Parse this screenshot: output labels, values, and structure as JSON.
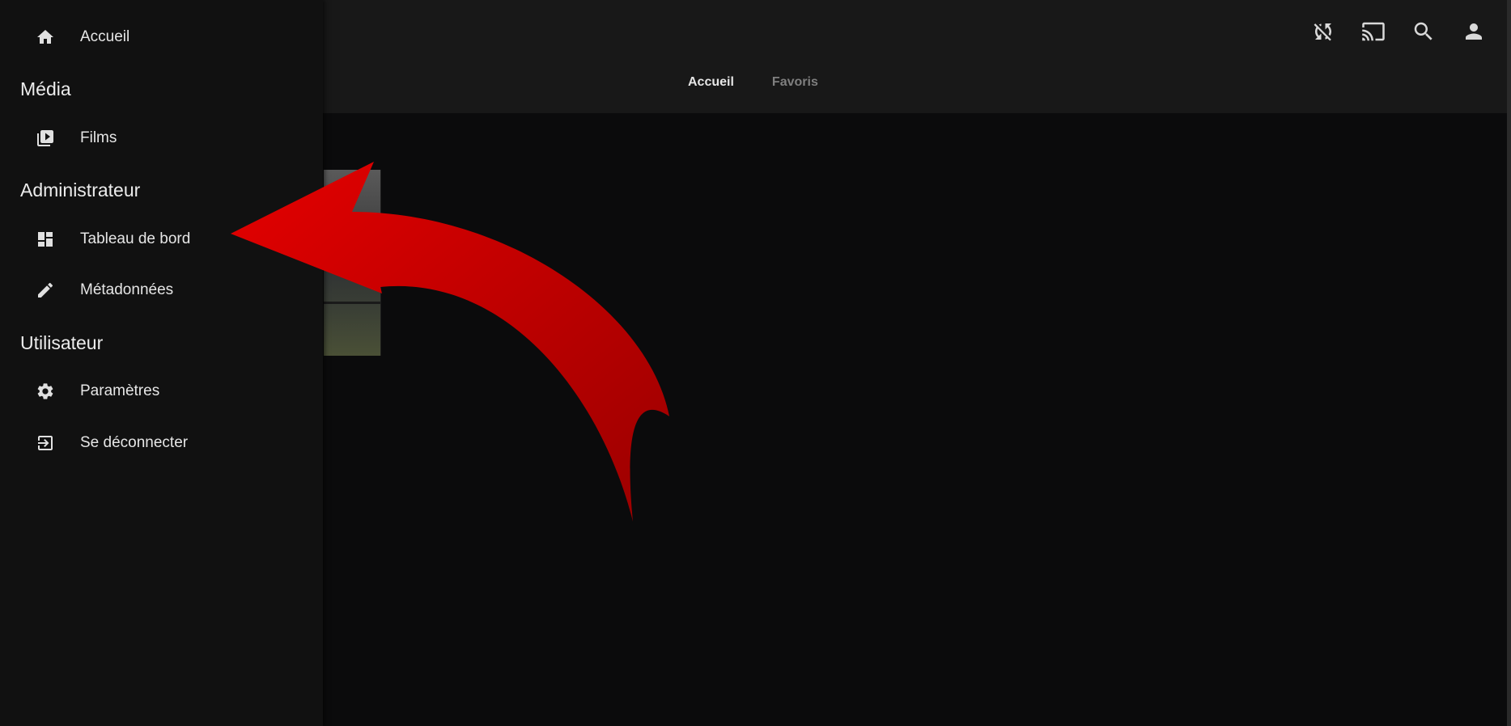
{
  "header": {
    "tabs": [
      {
        "label": "Accueil",
        "active": true
      },
      {
        "label": "Favoris",
        "active": false
      }
    ],
    "icons": [
      "sync-disabled-icon",
      "cast-icon",
      "search-icon",
      "user-icon"
    ]
  },
  "drawer": {
    "home": {
      "label": "Accueil",
      "icon": "home-icon"
    },
    "sections": [
      {
        "title": "Média",
        "items": [
          {
            "label": "Films",
            "icon": "video-library-icon"
          }
        ]
      },
      {
        "title": "Administrateur",
        "items": [
          {
            "label": "Tableau de bord",
            "icon": "dashboard-icon"
          },
          {
            "label": "Métadonnées",
            "icon": "pencil-icon"
          }
        ]
      },
      {
        "title": "Utilisateur",
        "items": [
          {
            "label": "Paramètres",
            "icon": "gear-icon"
          },
          {
            "label": "Se déconnecter",
            "icon": "logout-icon"
          }
        ]
      }
    ]
  },
  "annotation": {
    "type": "curved-arrow",
    "color": "#d40000",
    "points_to": "Tableau de bord"
  }
}
